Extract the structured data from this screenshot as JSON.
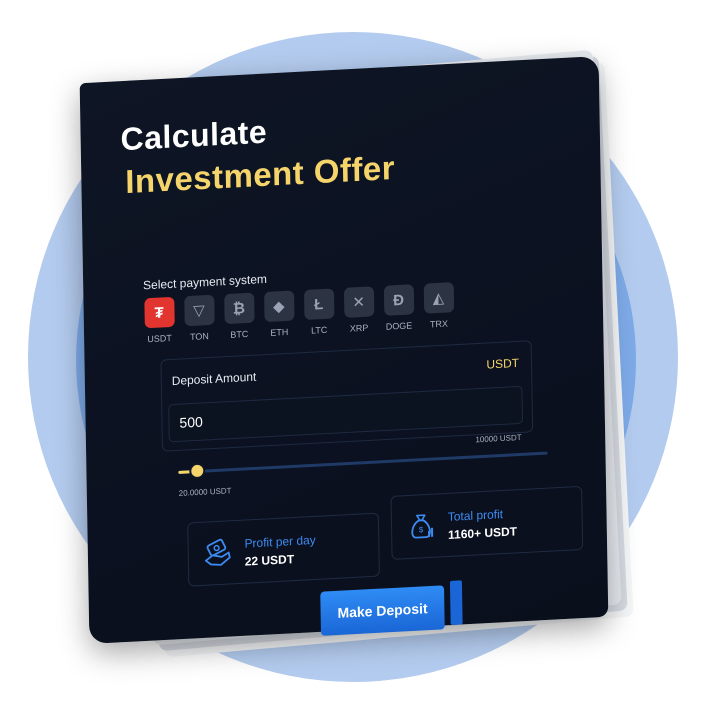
{
  "header": {
    "title_line1": "Calculate",
    "title_line2": "Investment Offer"
  },
  "payment": {
    "label": "Select payment system",
    "selected": "USDT",
    "systems": [
      {
        "code": "USDT",
        "icon": "tether-icon",
        "glyph": "₮"
      },
      {
        "code": "TON",
        "icon": "ton-icon",
        "glyph": "▽"
      },
      {
        "code": "BTC",
        "icon": "bitcoin-icon",
        "glyph": "₿"
      },
      {
        "code": "ETH",
        "icon": "ethereum-icon",
        "glyph": "◆"
      },
      {
        "code": "LTC",
        "icon": "litecoin-icon",
        "glyph": "Ł"
      },
      {
        "code": "XRP",
        "icon": "xrp-icon",
        "glyph": "✕"
      },
      {
        "code": "DOGE",
        "icon": "doge-icon",
        "glyph": "Đ"
      },
      {
        "code": "TRX",
        "icon": "tron-icon",
        "glyph": "◭"
      }
    ]
  },
  "deposit": {
    "label": "Deposit Amount",
    "currency": "USDT",
    "value": "500",
    "max_label": "10000 USDT",
    "min_label": "20.0000 USDT",
    "slider_level_percent": 5
  },
  "stats": {
    "profit_per_day_title": "Profit per day",
    "profit_per_day_value": "22 USDT",
    "total_profit_title": "Total profit",
    "total_profit_value": "1160+ USDT"
  },
  "actions": {
    "deposit_button": "Make Deposit"
  },
  "colors": {
    "background_outer": "#b3cbee",
    "background_inner": "#7eaae8",
    "card": "#0e1524",
    "accent_yellow": "#f4d46b",
    "accent_blue": "#2f8cf5",
    "active_coin": "#e2352f"
  }
}
